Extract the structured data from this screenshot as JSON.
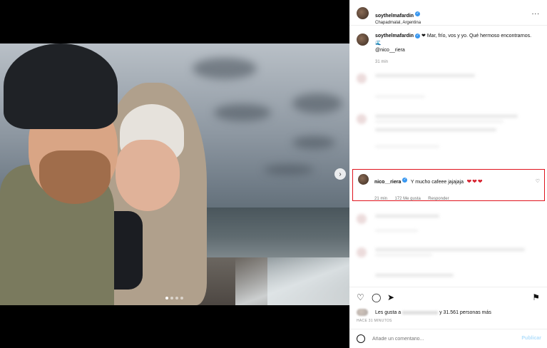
{
  "post": {
    "username": "soythelmafardin",
    "location": "Chapadmalal, Argentina",
    "more_label": "...",
    "caption_text": "❤ Mar, frío, vos y yo. Qué hermoso encontrarnos. 🌊",
    "caption_mention": "@nico__riera",
    "caption_time": "31 min"
  },
  "media": {
    "carousel_count": 4,
    "active_index": 0,
    "next_icon": "›"
  },
  "highlighted_comment": {
    "username": "nico__riera",
    "text": "Y mucho cafeee jajajaja",
    "hearts": "❤❤❤",
    "time": "21 min",
    "likes": "172 Me gusta",
    "reply_label": "Responder",
    "highlight_color": "#e0141e"
  },
  "actions": {
    "like_icon": "♡",
    "comment_icon": "◯",
    "share_icon": "➤",
    "save_icon": "⚑"
  },
  "likes_line": {
    "prefix": "Les gusta a",
    "suffix": "y 31.561 personas más"
  },
  "time_ago": "HACE 31 MINUTOS",
  "comment_box": {
    "placeholder": "Añade un comentario...",
    "publish_label": "Publicar"
  },
  "colors": {
    "verified": "#3897f0",
    "heart": "#d6222f"
  }
}
